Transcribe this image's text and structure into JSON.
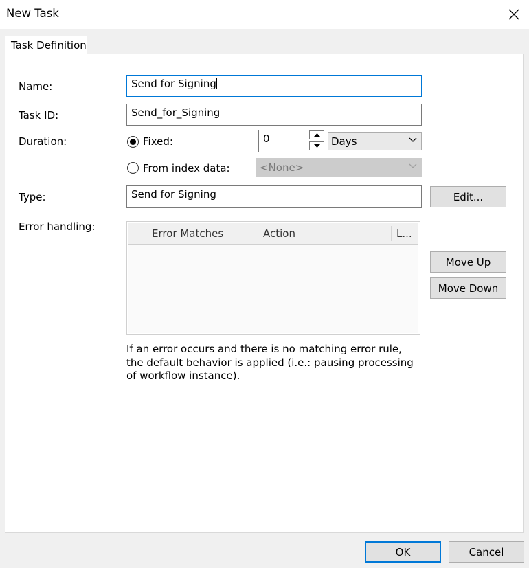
{
  "window": {
    "title": "New Task"
  },
  "tabs": [
    {
      "label": "Task Definition"
    }
  ],
  "form": {
    "name": {
      "label": "Name:",
      "value": "Send for Signing"
    },
    "task_id": {
      "label": "Task ID:",
      "value": "Send_for_Signing"
    },
    "duration": {
      "label": "Duration:",
      "fixed_label": "Fixed:",
      "fixed_selected": true,
      "fixed_value": "0",
      "unit": "Days",
      "index_label": "From index data:",
      "index_value": "<None>"
    },
    "type": {
      "label": "Type:",
      "value": "Send for Signing",
      "edit_button": "Edit..."
    },
    "error_handling": {
      "label": "Error handling:",
      "columns": [
        "Error Matches",
        "Action",
        "L..."
      ],
      "move_up": "Move Up",
      "move_down": "Move Down",
      "hint": "If an error occurs and there is no matching error rule, the default behavior is applied (i.e.: pausing processing of workflow instance)."
    }
  },
  "footer": {
    "ok": "OK",
    "cancel": "Cancel"
  }
}
